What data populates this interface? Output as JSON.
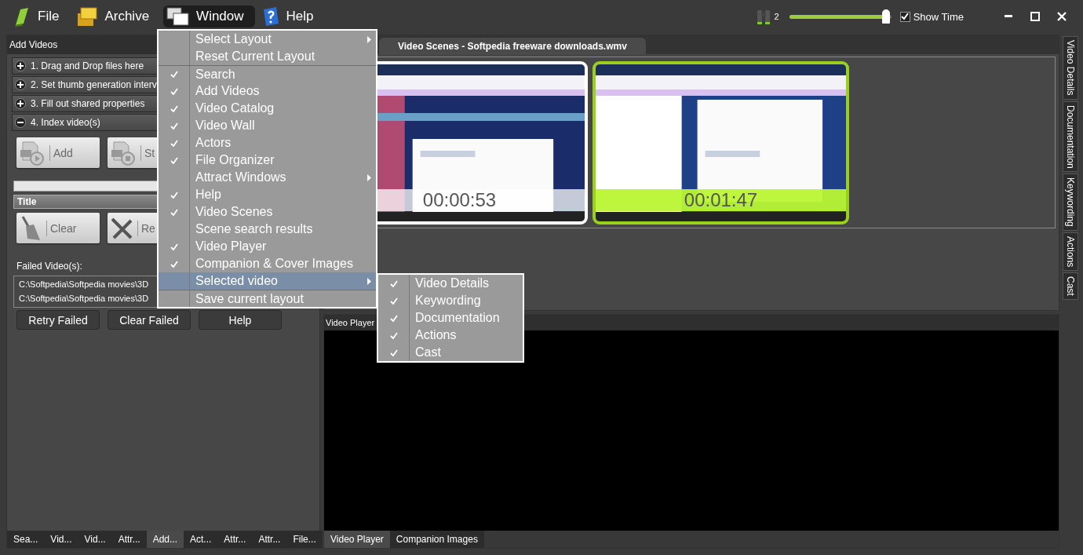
{
  "menubar": [
    {
      "label": "File",
      "kind": "file",
      "selected": false
    },
    {
      "label": "Archive",
      "kind": "archive",
      "selected": false
    },
    {
      "label": "Window",
      "kind": "window",
      "selected": true
    },
    {
      "label": "Help",
      "kind": "help",
      "selected": false
    }
  ],
  "zoom": {
    "value": "2",
    "level": 0.95
  },
  "show_time": {
    "label": "Show Time",
    "checked": true
  },
  "left_panel": {
    "title": "Add Videos",
    "steps": [
      {
        "label": "1. Drag and Drop files here",
        "expanded": false
      },
      {
        "label": "2. Set thumb generation interv",
        "expanded": false
      },
      {
        "label": "3. Fill out shared properties",
        "expanded": false
      },
      {
        "label": "4. Index video(s)",
        "expanded": true
      }
    ],
    "index_buttons": [
      {
        "label": "Add",
        "kind": "play"
      },
      {
        "label": "St",
        "kind": "stop"
      }
    ],
    "progress": {
      "level": 0
    },
    "column_header": "Title",
    "list_buttons": [
      {
        "label": "Clear",
        "kind": "broom"
      },
      {
        "label": "Re",
        "kind": "cross"
      }
    ],
    "failed_label": "Failed Video(s):",
    "failed_videos": [
      "C:\\Softpedia\\Softpedia movies\\3D",
      "C:\\Softpedia\\Softpedia movies\\3D"
    ],
    "footer_buttons": [
      "Retry Failed",
      "Clear Failed",
      "Help"
    ]
  },
  "left_tabs": [
    {
      "label": "Sea...",
      "selected": false
    },
    {
      "label": "Vid...",
      "selected": false
    },
    {
      "label": "Vid...",
      "selected": false
    },
    {
      "label": "Attr...",
      "selected": false
    },
    {
      "label": "Add...",
      "selected": true
    },
    {
      "label": "Act...",
      "selected": false
    },
    {
      "label": "Attr...",
      "selected": false
    },
    {
      "label": "Attr...",
      "selected": false
    },
    {
      "label": "File...",
      "selected": false
    }
  ],
  "scenes": {
    "tab": "Video Scenes - Softpedia freeware downloads.wmv",
    "thumbnails": [
      {
        "time": "00:00:53",
        "selected": false
      },
      {
        "time": "00:01:47",
        "selected": true
      }
    ]
  },
  "player": {
    "title": "Video Player",
    "tabs": [
      {
        "label": "Video Player",
        "selected": true
      },
      {
        "label": "Companion Images",
        "selected": false
      }
    ]
  },
  "side_tabs": [
    "Video Details",
    "Documentation",
    "Keywording",
    "Actions",
    "Cast"
  ],
  "window_menu": [
    {
      "label": "Select Layout",
      "checked": false,
      "submenu": true,
      "highlighted": false,
      "separator_before": false
    },
    {
      "label": "Reset Current Layout",
      "checked": false,
      "submenu": false,
      "highlighted": false,
      "separator_before": false
    },
    {
      "label": "Search",
      "checked": true,
      "submenu": false,
      "highlighted": false,
      "separator_before": true
    },
    {
      "label": "Add Videos",
      "checked": true,
      "submenu": false,
      "highlighted": false,
      "separator_before": false
    },
    {
      "label": "Video Catalog",
      "checked": true,
      "submenu": false,
      "highlighted": false,
      "separator_before": false
    },
    {
      "label": "Video Wall",
      "checked": true,
      "submenu": false,
      "highlighted": false,
      "separator_before": false
    },
    {
      "label": "Actors",
      "checked": true,
      "submenu": false,
      "highlighted": false,
      "separator_before": false
    },
    {
      "label": "File Organizer",
      "checked": true,
      "submenu": false,
      "highlighted": false,
      "separator_before": false
    },
    {
      "label": "Attract Windows",
      "checked": false,
      "submenu": true,
      "highlighted": false,
      "separator_before": false
    },
    {
      "label": "Help",
      "checked": true,
      "submenu": false,
      "highlighted": false,
      "separator_before": false
    },
    {
      "label": "Video Scenes",
      "checked": true,
      "submenu": false,
      "highlighted": false,
      "separator_before": false
    },
    {
      "label": "Scene search results",
      "checked": false,
      "submenu": false,
      "highlighted": false,
      "separator_before": false
    },
    {
      "label": "Video Player",
      "checked": true,
      "submenu": false,
      "highlighted": false,
      "separator_before": false
    },
    {
      "label": "Companion & Cover Images",
      "checked": true,
      "submenu": false,
      "highlighted": false,
      "separator_before": false
    },
    {
      "label": "Selected video",
      "checked": false,
      "submenu": true,
      "highlighted": true,
      "separator_before": false
    },
    {
      "label": "Save current layout",
      "checked": false,
      "submenu": false,
      "highlighted": false,
      "separator_before": true
    }
  ],
  "selected_video_menu": [
    {
      "label": "Video Details",
      "checked": true
    },
    {
      "label": "Keywording",
      "checked": true
    },
    {
      "label": "Documentation",
      "checked": true
    },
    {
      "label": "Actions",
      "checked": true
    },
    {
      "label": "Cast",
      "checked": true
    }
  ]
}
